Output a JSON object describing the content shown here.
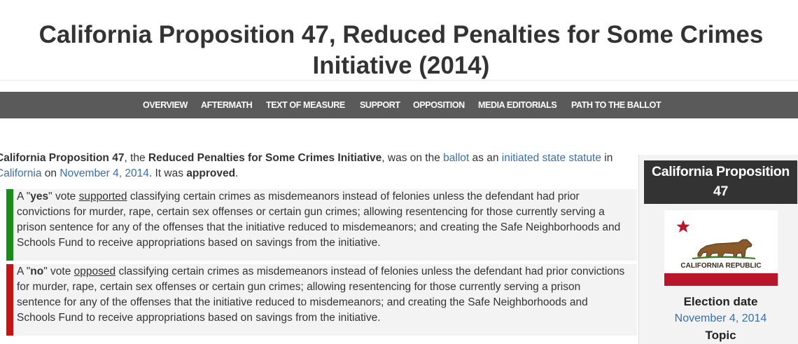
{
  "page": {
    "title_line1": "California Proposition 47, Reduced Penalties for Some Crimes",
    "title_line2": "Initiative (2014)"
  },
  "nav": {
    "items": [
      "OVERVIEW",
      "AFTERMATH",
      "TEXT OF MEASURE",
      "SUPPORT",
      "OPPOSITION",
      "MEDIA EDITORIALS",
      "PATH TO THE BALLOT"
    ]
  },
  "intro": {
    "measure_name": "California Proposition 47",
    "text_the": ", the ",
    "initiative_name": "Reduced Penalties for Some Crimes Initiative",
    "text_was_on_the": ", was on the ",
    "ballot_link": "ballot",
    "text_as_an": " as an ",
    "type_link": "initiated state statute",
    "text_in": " in ",
    "state_link": "California",
    "text_on": " on ",
    "date_link": "November 4, 2014",
    "text_it_was": ". It was ",
    "result": "approved",
    "text_period": "."
  },
  "votes": {
    "yes": {
      "prefix": "A \"",
      "word": "yes",
      "mid": "\" vote ",
      "action": "supported",
      "body": " classifying certain crimes as misdemeanors instead of felonies unless the defendant had prior convictions for murder, rape, certain sex offenses or certain gun crimes; allowing resentencing for those currently serving a prison sentence for any of the offenses that the initiative reduced to misdemeanors; and creating the Safe Neighborhoods and Schools Fund to receive appropriations based on savings from the initiative.",
      "color": "#1a8a1a"
    },
    "no": {
      "prefix": "A \"",
      "word": "no",
      "mid": "\" vote ",
      "action": "opposed",
      "body": " classifying certain crimes as misdemeanors instead of felonies unless the defendant had prior convictions for murder, rape, certain sex offenses or certain gun crimes; allowing resentencing for those currently serving a prison sentence for any of the offenses that the initiative reduced to misdemeanors; and creating the Safe Neighborhoods and Schools Fund to receive appropriations based on savings from the initiative.",
      "color": "#c41515"
    }
  },
  "infobox": {
    "title": "California Proposition 47",
    "flag_text": "CALIFORNIA REPUBLIC",
    "election_date_label": "Election date",
    "election_date_value": "November 4, 2014",
    "topic_label": "Topic"
  },
  "colors": {
    "nav_background": "#5a5a5a",
    "link": "#3a6fa5",
    "infobox_header": "#333333",
    "flag_red": "#b8162b"
  }
}
